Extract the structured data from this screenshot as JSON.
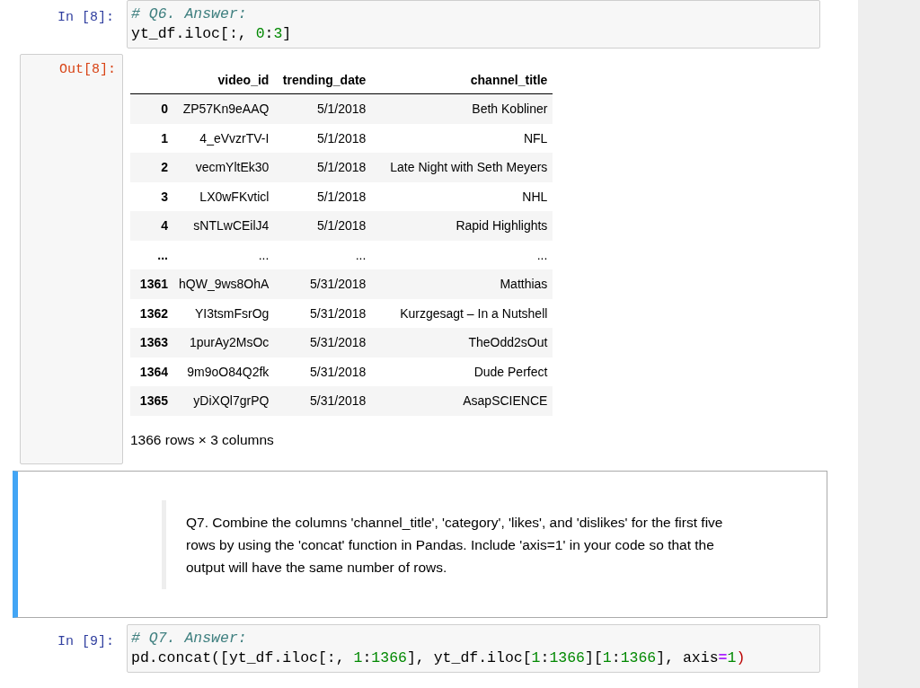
{
  "cells": [
    {
      "kind": "code",
      "prompt": "In [8]:",
      "lines": [
        [
          {
            "kind": "comment",
            "text": "# Q6. Answer:"
          }
        ],
        [
          {
            "kind": "plain",
            "text": "yt_df.iloc[:, "
          },
          {
            "kind": "number",
            "text": "0"
          },
          {
            "kind": "plain",
            "text": ":"
          },
          {
            "kind": "number",
            "text": "3"
          },
          {
            "kind": "plain",
            "text": "]"
          }
        ]
      ]
    },
    {
      "kind": "output",
      "prompt": "Out[8]:",
      "table": {
        "columns": [
          "video_id",
          "trending_date",
          "channel_title"
        ],
        "rows": [
          {
            "index": "0",
            "cells": [
              "ZP57Kn9eAAQ",
              "5/1/2018",
              "Beth Kobliner"
            ]
          },
          {
            "index": "1",
            "cells": [
              "4_eVvzrTV-I",
              "5/1/2018",
              "NFL"
            ]
          },
          {
            "index": "2",
            "cells": [
              "vecmYltEk30",
              "5/1/2018",
              "Late Night with Seth Meyers"
            ]
          },
          {
            "index": "3",
            "cells": [
              "LX0wFKvticl",
              "5/1/2018",
              "NHL"
            ]
          },
          {
            "index": "4",
            "cells": [
              "sNTLwCEilJ4",
              "5/1/2018",
              "Rapid Highlights"
            ]
          },
          {
            "index": "...",
            "cells": [
              "...",
              "...",
              "..."
            ]
          },
          {
            "index": "1361",
            "cells": [
              "hQW_9ws8OhA",
              "5/31/2018",
              "Matthias"
            ]
          },
          {
            "index": "1362",
            "cells": [
              "YI3tsmFsrOg",
              "5/31/2018",
              "Kurzgesagt – In a Nutshell"
            ]
          },
          {
            "index": "1363",
            "cells": [
              "1purAy2MsOc",
              "5/31/2018",
              "TheOdd2sOut"
            ]
          },
          {
            "index": "1364",
            "cells": [
              "9m9oO84Q2fk",
              "5/31/2018",
              "Dude Perfect"
            ]
          },
          {
            "index": "1365",
            "cells": [
              "yDiXQl7grPQ",
              "5/31/2018",
              "AsapSCIENCE"
            ]
          }
        ]
      },
      "summary": "1366 rows × 3 columns"
    },
    {
      "kind": "markdown",
      "selected": true,
      "quote": "Q7. Combine the columns 'channel_title', 'category', 'likes', and 'dislikes' for the first five rows by using the 'concat' function in Pandas. Include 'axis=1' in your code so that the output will have the same number of rows."
    },
    {
      "kind": "code",
      "prompt": "In [9]:",
      "lines": [
        [
          {
            "kind": "comment",
            "text": "# Q7. Answer:"
          }
        ],
        [
          {
            "kind": "plain",
            "text": "pd.concat([yt_df.iloc[:, "
          },
          {
            "kind": "number",
            "text": "1"
          },
          {
            "kind": "plain",
            "text": ":"
          },
          {
            "kind": "number",
            "text": "1366"
          },
          {
            "kind": "plain",
            "text": "], yt_df.iloc["
          },
          {
            "kind": "number",
            "text": "1"
          },
          {
            "kind": "plain",
            "text": ":"
          },
          {
            "kind": "number",
            "text": "1366"
          },
          {
            "kind": "plain",
            "text": "]["
          },
          {
            "kind": "number",
            "text": "1"
          },
          {
            "kind": "plain",
            "text": ":"
          },
          {
            "kind": "number",
            "text": "1366"
          },
          {
            "kind": "plain",
            "text": "], axis"
          },
          {
            "kind": "operator",
            "text": "="
          },
          {
            "kind": "number",
            "text": "1"
          },
          {
            "kind": "paren",
            "text": ")"
          }
        ]
      ]
    }
  ]
}
